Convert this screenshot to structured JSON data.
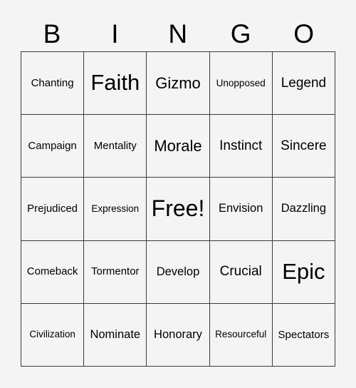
{
  "card": {
    "header_letters": [
      "B",
      "I",
      "N",
      "G",
      "O"
    ],
    "colors": {
      "background": "#f4f4f4",
      "grid_line": "#3a3a3a",
      "text": "#000000"
    },
    "rows": [
      [
        {
          "text": "Chanting",
          "size": "s"
        },
        {
          "text": "Faith",
          "size": "xxl"
        },
        {
          "text": "Gizmo",
          "size": "xl"
        },
        {
          "text": "Unopposed",
          "size": "xs"
        },
        {
          "text": "Legend",
          "size": "l"
        }
      ],
      [
        {
          "text": "Campaign",
          "size": "s"
        },
        {
          "text": "Mentality",
          "size": "s"
        },
        {
          "text": "Morale",
          "size": "xl"
        },
        {
          "text": "Instinct",
          "size": "l"
        },
        {
          "text": "Sincere",
          "size": "l"
        }
      ],
      [
        {
          "text": "Prejudiced",
          "size": "s"
        },
        {
          "text": "Expression",
          "size": "xs"
        },
        {
          "text": "Free!",
          "size": "free"
        },
        {
          "text": "Envision",
          "size": "m"
        },
        {
          "text": "Dazzling",
          "size": "m"
        }
      ],
      [
        {
          "text": "Comeback",
          "size": "s"
        },
        {
          "text": "Tormentor",
          "size": "s"
        },
        {
          "text": "Develop",
          "size": "m"
        },
        {
          "text": "Crucial",
          "size": "l"
        },
        {
          "text": "Epic",
          "size": "xxl"
        }
      ],
      [
        {
          "text": "Civilization",
          "size": "xs"
        },
        {
          "text": "Nominate",
          "size": "m"
        },
        {
          "text": "Honorary",
          "size": "m"
        },
        {
          "text": "Resourceful",
          "size": "xs"
        },
        {
          "text": "Spectators",
          "size": "s"
        }
      ]
    ]
  }
}
